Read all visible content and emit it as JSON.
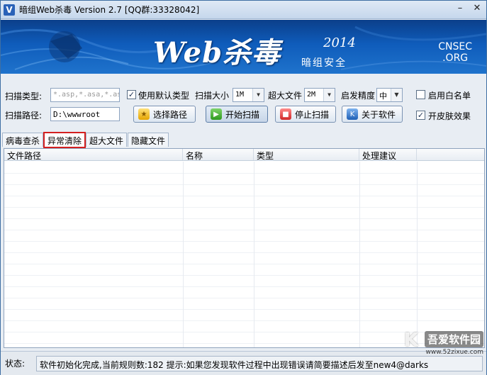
{
  "window": {
    "title": "暗组Web杀毒  Version 2.7  [QQ群:33328042]",
    "minimize": "–",
    "close": "✕"
  },
  "banner": {
    "title": "Web杀毒",
    "year": "2014",
    "subtitle": "暗组安全",
    "org_line1": "CNSEC",
    "org_line2": ".ORG"
  },
  "options": {
    "scan_type_label": "扫描类型:",
    "scan_type_value": "*.asp,*.asa,*.as",
    "use_default_type_label": "使用默认类型",
    "use_default_type_checked": true,
    "scan_size_label": "扫描大小",
    "scan_size_value": "1M",
    "large_file_label": "超大文件",
    "large_file_value": "2M",
    "heuristic_label": "启发精度",
    "heuristic_value": "中",
    "whitelist_label": "启用白名单",
    "whitelist_checked": false,
    "scan_path_label": "扫描路径:",
    "scan_path_value": "D:\\wwwroot",
    "skin_label": "开皮肤效果",
    "skin_checked": true
  },
  "buttons": {
    "choose_path": "选择路径",
    "start_scan": "开始扫描",
    "stop_scan": "停止扫描",
    "about": "关于软件"
  },
  "tabs": [
    {
      "label": "病毒查杀"
    },
    {
      "label": "异常清除"
    },
    {
      "label": "超大文件"
    },
    {
      "label": "隐藏文件"
    }
  ],
  "list": {
    "columns": [
      "文件路径",
      "名称",
      "类型",
      "处理建议",
      ""
    ]
  },
  "status": {
    "label": "状态:",
    "text": "软件初始化完成,当前规则数:182 提示:如果您发现软件过程中出现错误请简要描述后发至new4@darks"
  },
  "watermark": {
    "main": "吾爱软件园",
    "url": "www.52zixue.com"
  }
}
